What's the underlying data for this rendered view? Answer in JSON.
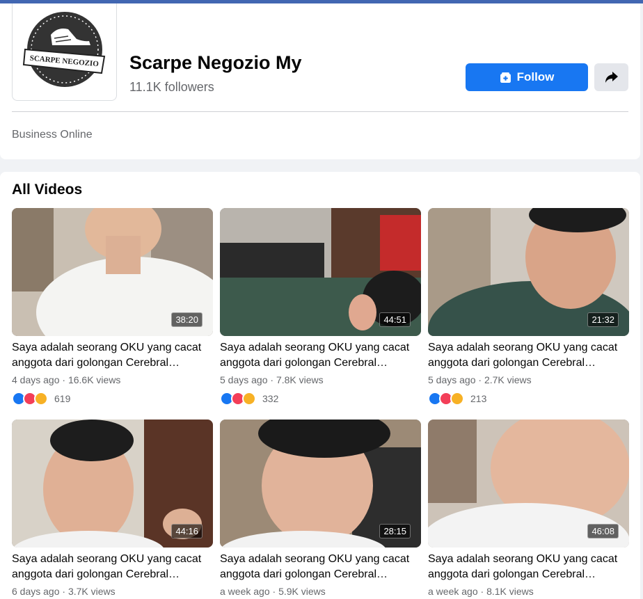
{
  "page": {
    "name": "Scarpe Negozio My",
    "followers": "11.1K followers",
    "category": "Business Online",
    "logo_text": "SCARPE NEGOZIO",
    "follow_label": "Follow"
  },
  "colors": {
    "brand": "#1877f2",
    "topbar": "#4267b2"
  },
  "section_title": "All Videos",
  "videos": [
    {
      "title": "Saya adalah seorang OKU yang cacat anggota dari golongan Cerebral…",
      "age": "4 days ago",
      "views": "16.6K views",
      "duration": "38:20",
      "reactions": "619"
    },
    {
      "title": "Saya adalah seorang OKU yang cacat anggota dari golongan Cerebral…",
      "age": "5 days ago",
      "views": "7.8K views",
      "duration": "44:51",
      "reactions": "332"
    },
    {
      "title": "Saya adalah seorang OKU yang cacat anggota dari golongan Cerebral…",
      "age": "5 days ago",
      "views": "2.7K views",
      "duration": "21:32",
      "reactions": "213"
    },
    {
      "title": "Saya adalah seorang OKU yang cacat anggota dari golongan Cerebral…",
      "age": "6 days ago",
      "views": "3.7K views",
      "duration": "44:16"
    },
    {
      "title": "Saya adalah seorang OKU yang cacat anggota dari golongan Cerebral…",
      "age": "a week ago",
      "views": "5.9K views",
      "duration": "28:15"
    },
    {
      "title": "Saya adalah seorang OKU yang cacat anggota dari golongan Cerebral…",
      "age": "a week ago",
      "views": "8.1K views",
      "duration": "46:08"
    }
  ],
  "icons": {
    "follow": "add-page-icon",
    "share": "share-arrow-icon",
    "like": "like-reaction-icon",
    "love": "love-reaction-icon",
    "care": "care-reaction-icon"
  }
}
